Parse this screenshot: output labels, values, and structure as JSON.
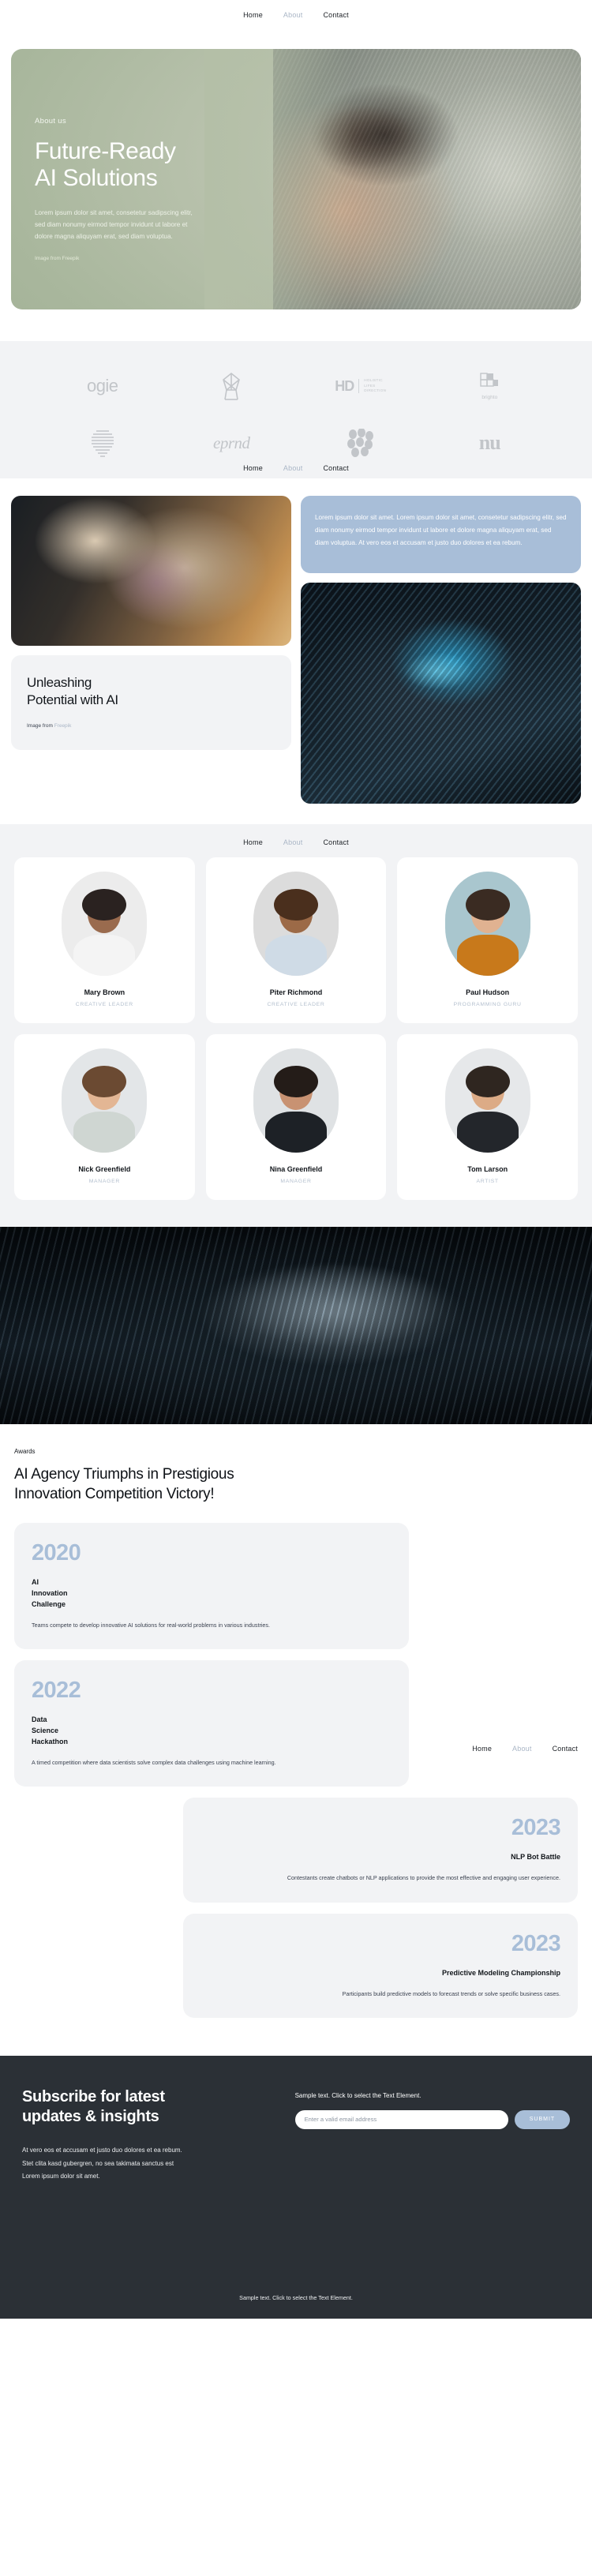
{
  "nav": {
    "items": [
      {
        "label": "Home",
        "muted": false
      },
      {
        "label": "About",
        "muted": true
      },
      {
        "label": "Contact",
        "muted": false
      }
    ]
  },
  "hero": {
    "kicker": "About us",
    "title_line1": "Future-Ready",
    "title_line2": "AI Solutions",
    "paragraph": "Lorem ipsum dolor sit amet, consetetur sadipscing elitr, sed diam nonumy eirmod tempor invidunt ut labore et dolore magna aliquyam erat, sed diam voluptua.",
    "credit": "Image from Freepik",
    "bg_color": "#b4bfa7"
  },
  "logos": {
    "items": [
      {
        "name": "ogie",
        "type": "word"
      },
      {
        "name": "flower-mark",
        "type": "mark"
      },
      {
        "name": "HD",
        "type": "hd",
        "sub1": "HOLISTIC",
        "sub2": "LIFES",
        "sub3": "DIRECTION"
      },
      {
        "name": "brighto",
        "type": "brighto"
      },
      {
        "name": "striped-circle",
        "type": "mark"
      },
      {
        "name": "eprnd",
        "type": "serif"
      },
      {
        "name": "dots-mark",
        "type": "mark"
      },
      {
        "name": "nu",
        "type": "nu"
      }
    ]
  },
  "showcase": {
    "blue_card_text": "Lorem ipsum dolor sit amet. Lorem ipsum dolor sit amet, consetetur sadipscing elitr, sed diam nonumy eirmod tempor invidunt ut labore et dolore magna aliquyam erat, sed diam voluptua. At vero eos et accusam et justo duo dolores et ea rebum.",
    "card_title_line1": "Unleashing",
    "card_title_line2": "Potential with AI",
    "credit_prefix": "Image from ",
    "credit_link": "Freepik",
    "blue_color": "#a8bed8"
  },
  "team": {
    "members": [
      {
        "name": "Mary Brown",
        "role": "CREATIVE LEADER",
        "bg": "#ececec",
        "skin": "#9a6b4e",
        "hair": "#2a2220",
        "shirt": "#f4f4f4"
      },
      {
        "name": "Piter Richmond",
        "role": "CREATIVE LEADER",
        "bg": "#dcdcdc",
        "skin": "#9c6a47",
        "hair": "#4a2f1d",
        "shirt": "#cfdbe6"
      },
      {
        "name": "Paul Hudson",
        "role": "PROGRAMMING GURU",
        "bg": "#a9c6ce",
        "skin": "#e0b291",
        "hair": "#3a2b22",
        "shirt": "#c8791b"
      },
      {
        "name": "Nick Greenfield",
        "role": "MANAGER",
        "bg": "#e3e6e8",
        "skin": "#e3b694",
        "hair": "#6b4a32",
        "shirt": "#cfd6d2"
      },
      {
        "name": "Nina Greenfield",
        "role": "MANAGER",
        "bg": "#dfe2e4",
        "skin": "#c89272",
        "hair": "#241c18",
        "shirt": "#1d2126"
      },
      {
        "name": "Tom Larson",
        "role": "ARTIST",
        "bg": "#e6e8ea",
        "skin": "#dcab86",
        "hair": "#2f2620",
        "shirt": "#23262b"
      }
    ]
  },
  "awards": {
    "kicker": "Awards",
    "title_line1": "AI Agency Triumphs in Prestigious",
    "title_line2": "Innovation Competition Victory!",
    "year_color": "#a8bed8",
    "cards": [
      {
        "year": "2020",
        "name_lines": [
          "AI",
          "Innovation",
          "Challenge"
        ],
        "desc": "Teams compete to develop innovative AI solutions for real-world problems in various industries.",
        "align": "left"
      },
      {
        "year": "2022",
        "name_lines": [
          "Data",
          "Science",
          "Hackathon"
        ],
        "desc": "A timed competition where data scientists solve complex data challenges using machine learning.",
        "align": "left"
      },
      {
        "year": "2023",
        "name_lines": [
          "NLP Bot Battle"
        ],
        "desc": "Contestants create chatbots or NLP applications to provide the most effective and engaging user experience.",
        "align": "right"
      },
      {
        "year": "2023",
        "name_lines": [
          "Predictive Modeling Championship"
        ],
        "desc": "Participants build predictive models to forecast trends or solve specific business cases.",
        "align": "right"
      }
    ]
  },
  "footer": {
    "title_line1": "Subscribe for latest",
    "title_line2": "updates & insights",
    "text_line1": "At vero eos et accusam et justo duo dolores et ea rebum.",
    "text_line2": "Stet clita kasd gubergren, no sea takimata sanctus est",
    "text_line3": "Lorem ipsum dolor sit amet.",
    "sample_text": "Sample text. Click to select the Text Element.",
    "email_placeholder": "Enter a valid email address",
    "email_value": "",
    "submit_label": "SUBMIT",
    "bottom_text": "Sample text. Click to select the Text Element.",
    "bg_color": "#2b3036",
    "accent": "#a8bed8"
  }
}
